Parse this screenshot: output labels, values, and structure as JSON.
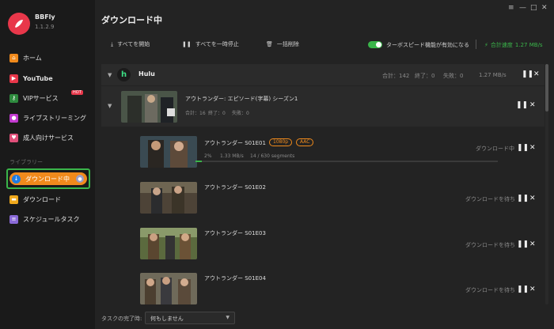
{
  "app": {
    "name": "BBFly",
    "version": "1.1.2.9"
  },
  "window": {
    "menu": "≡",
    "minimize": "—",
    "maximize": "□",
    "close": "✕"
  },
  "sidebar": {
    "items": [
      {
        "label": "ホーム",
        "icon": "home-icon"
      },
      {
        "label": "YouTube",
        "icon": "youtube-icon"
      },
      {
        "label": "VIPサービス",
        "icon": "key-icon",
        "badge": "HOT"
      },
      {
        "label": "ライブストリーミング",
        "icon": "live-icon"
      },
      {
        "label": "成人向けサービス",
        "icon": "adult-icon"
      }
    ],
    "section_label": "ライブラリー",
    "library": [
      {
        "label": "ダウンロード中",
        "icon": "download-icon",
        "active": true
      },
      {
        "label": "ダウンロード",
        "icon": "folder-icon"
      },
      {
        "label": "スケジュールタスク",
        "icon": "schedule-icon"
      }
    ]
  },
  "page_title": "ダウンロード中",
  "toolbar": {
    "start_all": "すべてを開始",
    "pause_all": "すべてを一時停止",
    "clear_all": "一括削除",
    "turbo_label": "ターボスピード機能が有効になる",
    "total_speed_label": "合計速度",
    "total_speed_value": "1.27 MB/s"
  },
  "group": {
    "name": "Hulu",
    "total": "合計：142",
    "done": "終了：0",
    "failed": "失敗：0",
    "speed": "1.27 MB/s"
  },
  "season": {
    "title": "アウトランダー: エピソード(字幕) シーズン1",
    "total": "合計：16",
    "done": "終了：0",
    "failed": "失敗：0"
  },
  "episodes": [
    {
      "title": "アウトランダー  S01E01",
      "tags": [
        "1080p",
        "AAC"
      ],
      "progress_text": "2%",
      "speed": "1.33 MB/s",
      "segments": "14 / 630 segments",
      "progress": 0.02,
      "status": "ダウンロード中"
    },
    {
      "title": "アウトランダー  S01E02",
      "status": "ダウンロードを待ち"
    },
    {
      "title": "アウトランダー  S01E03",
      "status": "ダウンロードを待ち"
    },
    {
      "title": "アウトランダー  S01E04",
      "status": "ダウンロードを待ち"
    }
  ],
  "controls": {
    "pause": "❚❚",
    "close": "✕"
  },
  "footer": {
    "label": "タスクの完了時:",
    "select_value": "何もしません"
  },
  "colors": {
    "accent_green": "#3ab54a",
    "accent_orange": "#f08a1c",
    "brand_red": "#e8374a"
  }
}
